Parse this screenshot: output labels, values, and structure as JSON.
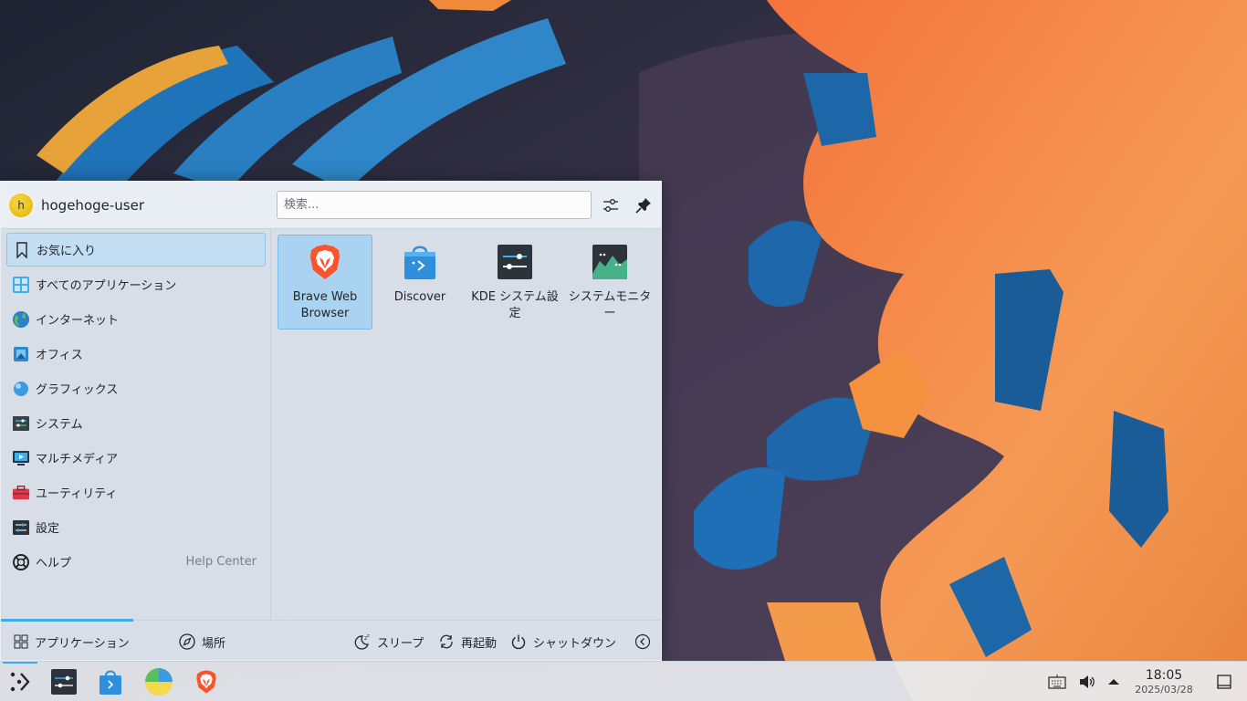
{
  "launcher": {
    "user": {
      "avatar_letter": "h",
      "name": "hogehoge-user"
    },
    "search": {
      "placeholder": "検索..."
    },
    "categories": [
      {
        "label": "お気に入り",
        "icon": "bookmark-icon",
        "active": true
      },
      {
        "label": "すべてのアプリケーション",
        "icon": "all-apps-icon"
      },
      {
        "label": "インターネット",
        "icon": "globe-icon"
      },
      {
        "label": "オフィス",
        "icon": "office-icon"
      },
      {
        "label": "グラフィックス",
        "icon": "graphics-icon"
      },
      {
        "label": "システム",
        "icon": "system-icon"
      },
      {
        "label": "マルチメディア",
        "icon": "multimedia-icon"
      },
      {
        "label": "ユーティリティ",
        "icon": "utilities-icon"
      },
      {
        "label": "設定",
        "icon": "settings-icon"
      },
      {
        "label": "ヘルプ",
        "icon": "help-icon",
        "sublabel": "Help Center"
      }
    ],
    "favorites": [
      {
        "label": "Brave Web Browser",
        "icon": "brave-icon",
        "selected": true
      },
      {
        "label": "Discover",
        "icon": "discover-icon"
      },
      {
        "label": "KDE システム設定",
        "icon": "system-settings-icon"
      },
      {
        "label": "システムモニター",
        "icon": "system-monitor-icon"
      }
    ],
    "footer": {
      "tab_applications": "アプリケーション",
      "tab_places": "場所",
      "sleep": "スリープ",
      "restart": "再起動",
      "shutdown": "シャットダウン"
    }
  },
  "taskbar": {
    "pinned": [
      "application-launcher-icon",
      "system-settings-icon",
      "discover-icon",
      "filelight-icon",
      "brave-icon"
    ],
    "clock": {
      "time": "18:05",
      "date": "2025/03/28"
    }
  },
  "colors": {
    "accent": "#3daee9",
    "selection": "#a9d3f1",
    "wallpaper_orange": "#f0823a",
    "wallpaper_blue": "#1c5fa0"
  }
}
